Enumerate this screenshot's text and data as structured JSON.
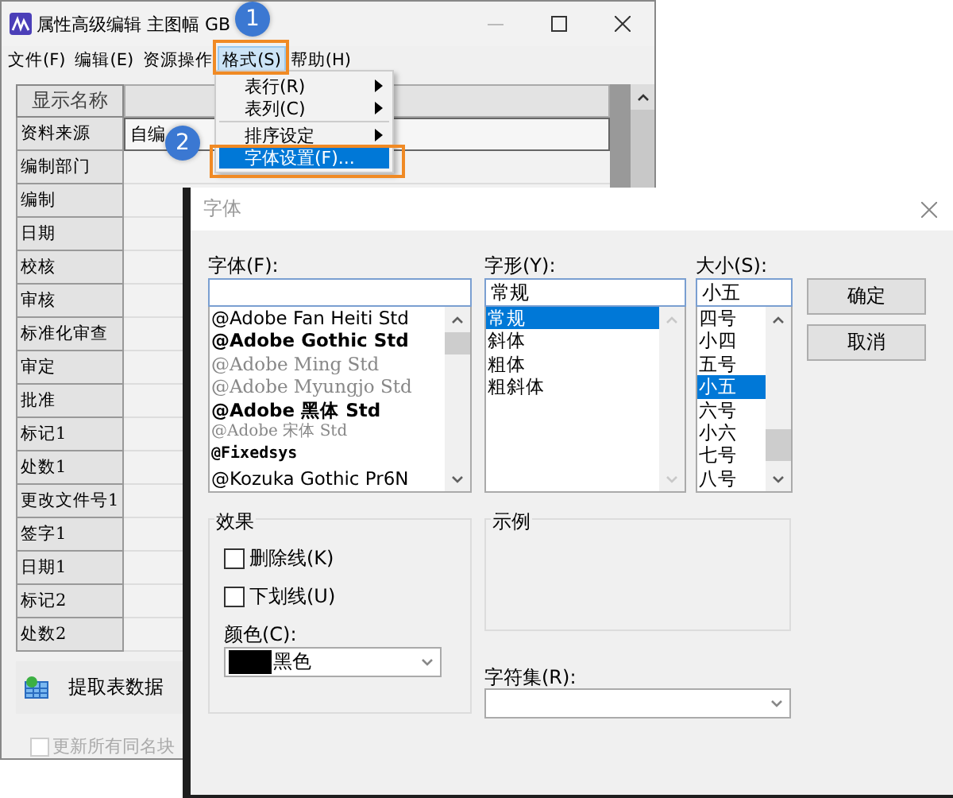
{
  "main_window": {
    "title": "属性高级编辑 主图幅 GB",
    "menu": [
      {
        "label": "文件(F)",
        "selected": false
      },
      {
        "label": "编辑(E)",
        "selected": false
      },
      {
        "label": "资源操作",
        "selected": false
      },
      {
        "label": "格式(S)",
        "selected": true
      },
      {
        "label": "帮助(H)",
        "selected": false
      }
    ],
    "table": {
      "columns": [
        "显示名称"
      ],
      "rows": [
        {
          "name": "资料来源",
          "value": "自编"
        },
        {
          "name": "编制部门"
        },
        {
          "name": "编制"
        },
        {
          "name": "日期"
        },
        {
          "name": "校核"
        },
        {
          "name": "审核"
        },
        {
          "name": "标准化审查"
        },
        {
          "name": "审定"
        },
        {
          "name": "批准"
        },
        {
          "name": "标记1"
        },
        {
          "name": "处数1"
        },
        {
          "name": "更改文件号1"
        },
        {
          "name": "签字1"
        },
        {
          "name": "日期1"
        },
        {
          "name": "标记2"
        },
        {
          "name": "处数2"
        }
      ]
    },
    "toolbar_button": "提取表数据",
    "checkbox": {
      "label": "更新所有同名块",
      "checked": false,
      "disabled": true
    }
  },
  "format_menu": {
    "items": [
      {
        "label": "表行(R)",
        "has_submenu": true,
        "separator_before": false,
        "selected": false
      },
      {
        "label": "表列(C)",
        "has_submenu": true,
        "separator_before": false,
        "selected": false
      },
      {
        "label": "排序设定",
        "has_submenu": true,
        "separator_before": true,
        "selected": false
      },
      {
        "label": "字体设置(F)...",
        "has_submenu": false,
        "separator_before": false,
        "selected": true
      }
    ]
  },
  "annotations": [
    "1",
    "2"
  ],
  "font_dialog": {
    "title": "字体",
    "font": {
      "label": "字体(F):",
      "items": [
        {
          "label": "@Adobe Fan Heiti Std",
          "kind": "sans"
        },
        {
          "label": "@Adobe Gothic Std",
          "kind": "bold"
        },
        {
          "label": "@Adobe Ming Std",
          "kind": "serif"
        },
        {
          "label": "@Adobe Myungjo Std",
          "kind": "serif"
        },
        {
          "label": "@Adobe 黑体 Std",
          "kind": "bold"
        },
        {
          "label": "@Adobe 宋体 Std",
          "kind": "serif-small"
        },
        {
          "label": "@Fixedsys",
          "kind": "mono"
        },
        {
          "label": "@Kozuka Gothic Pr6N",
          "kind": "sans"
        }
      ]
    },
    "style": {
      "label": "字形(Y):",
      "value": "常规",
      "items": [
        {
          "label": "常规",
          "selected": true
        },
        {
          "label": "斜体",
          "selected": false
        },
        {
          "label": "粗体",
          "selected": false
        },
        {
          "label": "粗斜体",
          "selected": false
        }
      ]
    },
    "size": {
      "label": "大小(S):",
      "value": "小五",
      "items": [
        {
          "label": "四号",
          "selected": false
        },
        {
          "label": "小四",
          "selected": false
        },
        {
          "label": "五号",
          "selected": false
        },
        {
          "label": "小五",
          "selected": true
        },
        {
          "label": "六号",
          "selected": false
        },
        {
          "label": "小六",
          "selected": false
        },
        {
          "label": "七号",
          "selected": false
        },
        {
          "label": "八号",
          "selected": false
        }
      ]
    },
    "buttons": [
      "确定",
      "取消"
    ],
    "effects": {
      "title": "效果",
      "checkboxes": [
        {
          "label": "删除线(K)",
          "checked": false
        },
        {
          "label": "下划线(U)",
          "checked": false
        }
      ],
      "color_label": "颜色(C):",
      "color": {
        "label": "黑色",
        "color": "#000000"
      }
    },
    "sample": {
      "title": "示例"
    },
    "charset": {
      "label": "字符集(R):"
    }
  }
}
